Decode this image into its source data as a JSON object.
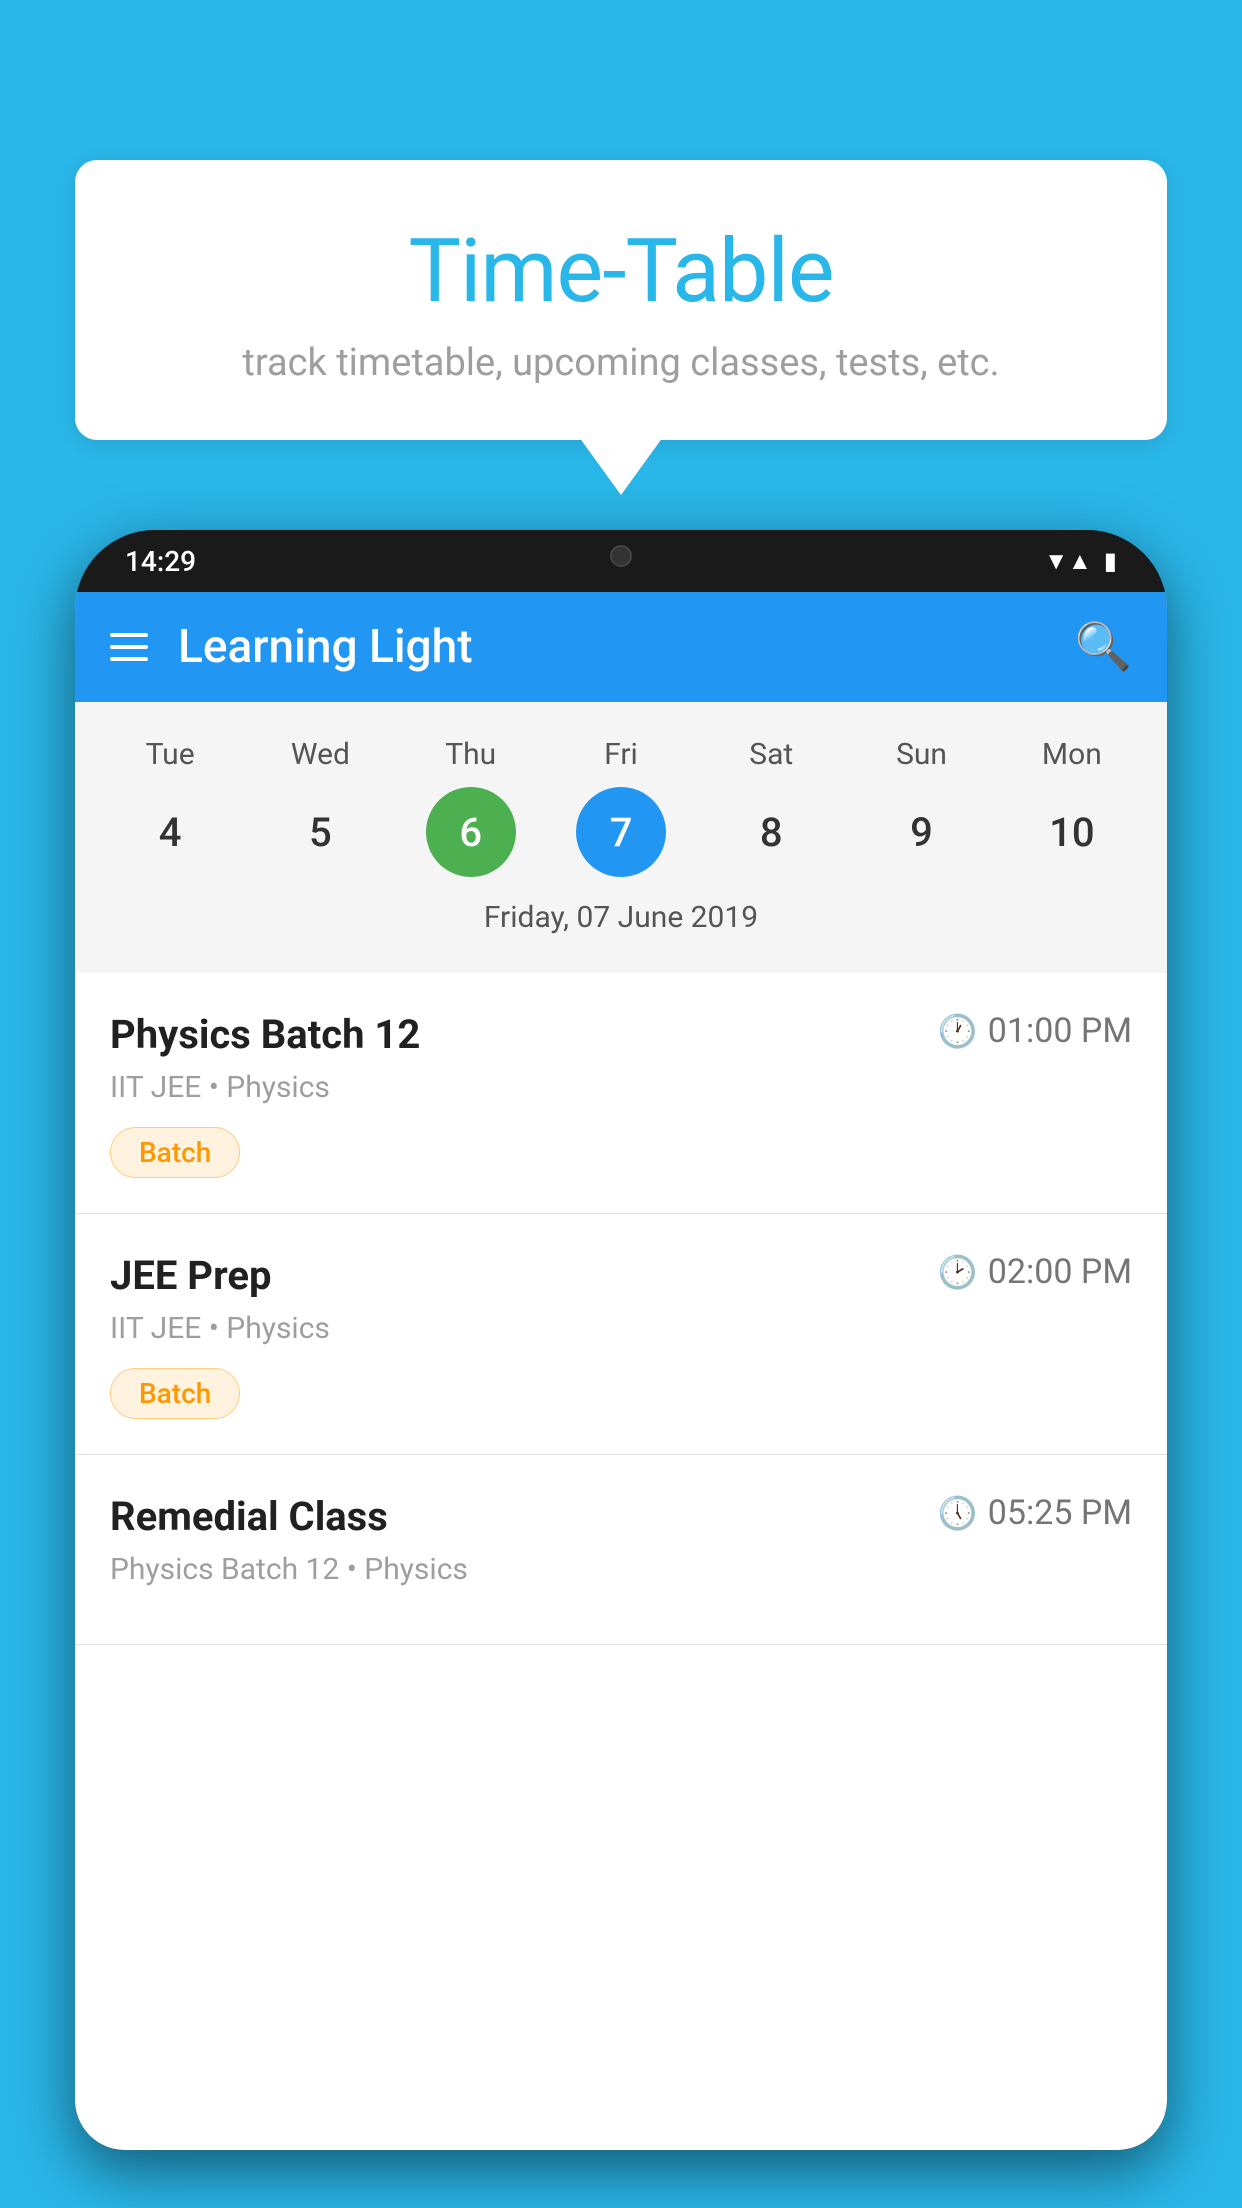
{
  "background_color": "#29b6e8",
  "bubble": {
    "title": "Time-Table",
    "subtitle": "track timetable, upcoming classes, tests, etc."
  },
  "app_bar": {
    "title": "Learning Light",
    "time": "14:29"
  },
  "calendar": {
    "days": [
      "Tue",
      "Wed",
      "Thu",
      "Fri",
      "Sat",
      "Sun",
      "Mon"
    ],
    "dates": [
      "4",
      "5",
      "6",
      "7",
      "8",
      "9",
      "10"
    ],
    "today_index": 2,
    "selected_index": 3,
    "selected_label": "Friday, 07 June 2019"
  },
  "schedule": [
    {
      "title": "Physics Batch 12",
      "time": "01:00 PM",
      "subtitle": "IIT JEE • Physics",
      "badge": "Batch"
    },
    {
      "title": "JEE Prep",
      "time": "02:00 PM",
      "subtitle": "IIT JEE • Physics",
      "badge": "Batch"
    },
    {
      "title": "Remedial Class",
      "time": "05:25 PM",
      "subtitle": "Physics Batch 12 • Physics",
      "badge": null
    }
  ],
  "icons": {
    "hamburger": "☰",
    "search": "🔍",
    "clock": "🕐"
  }
}
